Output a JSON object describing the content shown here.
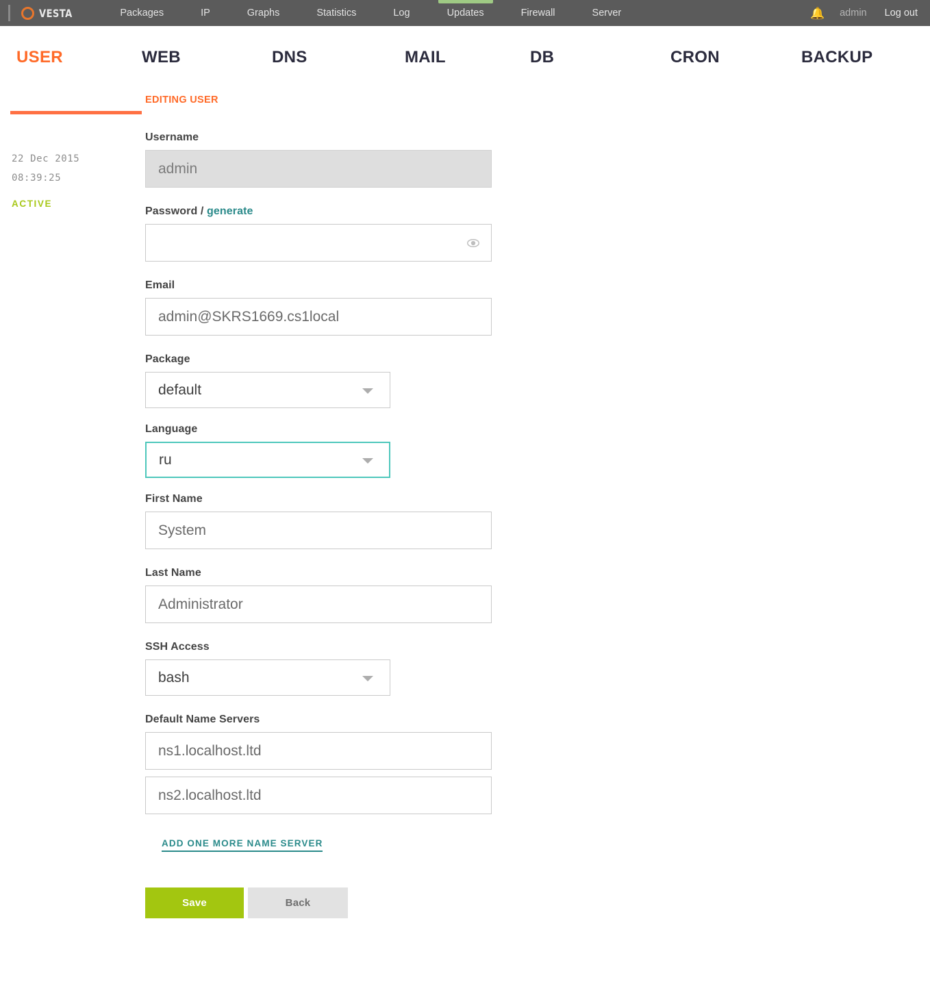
{
  "topbar": {
    "brand": "VESTA",
    "brand_icon": "vesta-ring-logo",
    "nav": [
      {
        "label": "Packages",
        "highlight": false
      },
      {
        "label": "IP",
        "highlight": false
      },
      {
        "label": "Graphs",
        "highlight": false
      },
      {
        "label": "Statistics",
        "highlight": false
      },
      {
        "label": "Log",
        "highlight": false
      },
      {
        "label": "Updates",
        "highlight": true
      },
      {
        "label": "Firewall",
        "highlight": false
      },
      {
        "label": "Server",
        "highlight": false
      }
    ],
    "bell_icon": "bell-icon",
    "user": "admin",
    "logout": "Log out",
    "highlight_color": "#9fca84"
  },
  "subnav": {
    "items": [
      {
        "label": "USER",
        "active": true
      },
      {
        "label": "WEB",
        "active": false
      },
      {
        "label": "DNS",
        "active": false
      },
      {
        "label": "MAIL",
        "active": false
      },
      {
        "label": "DB",
        "active": false
      },
      {
        "label": "CRON",
        "active": false
      },
      {
        "label": "BACKUP",
        "active": false
      }
    ],
    "active_color": "#ff6a28"
  },
  "sidebar": {
    "date": "22 Dec 2015",
    "time": "08:39:25",
    "status": "ACTIVE",
    "status_color": "#a8c81a"
  },
  "form": {
    "heading": "EDITING USER",
    "username": {
      "label": "Username",
      "value": "admin",
      "readonly": true
    },
    "password": {
      "label": "Password /",
      "generate_label": "generate",
      "value": "",
      "placeholder": "",
      "eye_icon": "eye-icon"
    },
    "email": {
      "label": "Email",
      "value": "admin@SKRS1669.cs1local"
    },
    "package": {
      "label": "Package",
      "value": "default",
      "caret_icon": "chevron-down-icon"
    },
    "language": {
      "label": "Language",
      "value": "ru",
      "focused": true,
      "focus_color": "#4dc7bb",
      "caret_icon": "chevron-down-icon"
    },
    "first_name": {
      "label": "First Name",
      "value": "System"
    },
    "last_name": {
      "label": "Last Name",
      "value": "Administrator"
    },
    "ssh_access": {
      "label": "SSH Access",
      "value": "bash",
      "caret_icon": "chevron-down-icon"
    },
    "name_servers": {
      "label": "Default Name Servers",
      "values": [
        "ns1.localhost.ltd",
        "ns2.localhost.ltd"
      ],
      "add_label": "ADD ONE MORE NAME SERVER"
    },
    "buttons": {
      "save": "Save",
      "back": "Back",
      "save_color": "#a3c610",
      "back_color": "#e2e2e2"
    }
  }
}
